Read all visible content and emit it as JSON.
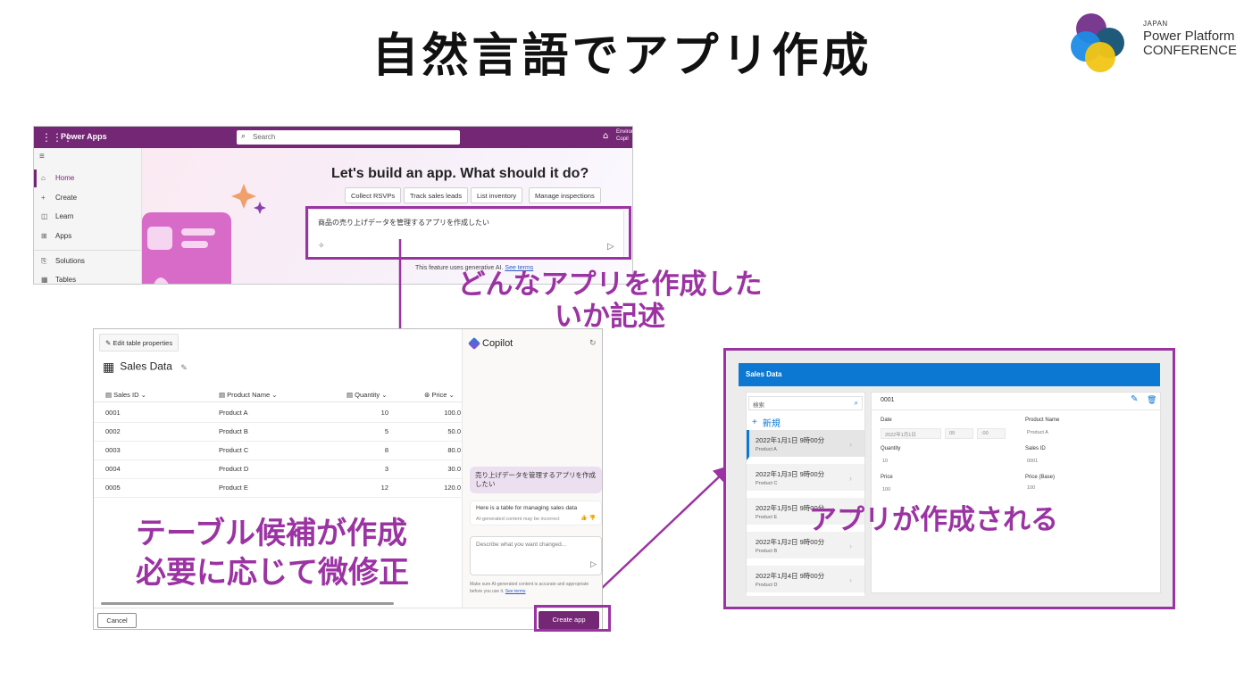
{
  "slide": {
    "title": "自然言語でアプリ作成",
    "logo": {
      "line1": "JAPAN",
      "line2": "Power Platform",
      "line3": "CONFERENCE"
    },
    "captions": {
      "describe": "どんなアプリを作成した\nいか記述",
      "table": "テーブル候補が作成\n必要に応じて微修正",
      "app": "アプリが作成される"
    },
    "accent_color": "#9b33a3"
  },
  "power_apps": {
    "app_name": "Power Apps",
    "search_placeholder": "Search",
    "env_label": "Environ\nCopil",
    "nav": [
      {
        "label": "Home",
        "icon": "home-icon",
        "glyph": "⌂"
      },
      {
        "label": "Create",
        "icon": "plus-icon",
        "glyph": "+"
      },
      {
        "label": "Learn",
        "icon": "book-icon",
        "glyph": "◫"
      },
      {
        "label": "Apps",
        "icon": "apps-icon",
        "glyph": "⊞"
      },
      {
        "label": "Solutions",
        "icon": "solutions-icon",
        "glyph": "⎘"
      },
      {
        "label": "Tables",
        "icon": "tables-icon",
        "glyph": "▦"
      }
    ],
    "heading": "Let's build an app. What should it do?",
    "suggestions": [
      "Collect RSVPs",
      "Track sales leads",
      "List inventory",
      "Manage inspections"
    ],
    "prompt_value": "商品の売り上げデータを管理するアプリを作成したい",
    "disclaimer": "This feature uses generative AI.",
    "disclaimer_link": "See terms",
    "brand_color": "#742774"
  },
  "table_editor": {
    "edit_button": "Edit table properties",
    "table_title": "Sales Data",
    "columns": [
      "Sales ID",
      "Product Name",
      "Quantity",
      "Price"
    ],
    "rows": [
      [
        "0001",
        "Product A",
        "10",
        "100.0"
      ],
      [
        "0002",
        "Product B",
        "5",
        "50.0"
      ],
      [
        "0003",
        "Product C",
        "8",
        "80.0"
      ],
      [
        "0004",
        "Product D",
        "3",
        "30.0"
      ],
      [
        "0005",
        "Product E",
        "12",
        "120.0"
      ]
    ],
    "cancel_label": "Cancel",
    "create_label": "Create app",
    "copilot": {
      "title": "Copilot",
      "user_message": "売り上げデータを管理するアプリを作成したい",
      "bot_message": "Here is a table for managing sales data",
      "bot_sub": "AI-generated content may be incorrect",
      "input_placeholder": "Describe what you want changed...",
      "note": "Make sure AI-generated content is accurate and appropriate before you use it.",
      "note_link": "See terms"
    }
  },
  "generated_app": {
    "header": "Sales Data",
    "search_placeholder": "検索",
    "new_label": "新規",
    "items": [
      {
        "title": "2022年1月1日 9時00分",
        "sub": "Product A"
      },
      {
        "title": "2022年1月3日 9時00分",
        "sub": "Product C"
      },
      {
        "title": "2022年1月5日 9時00分",
        "sub": "Product E"
      },
      {
        "title": "2022年1月2日 9時00分",
        "sub": "Product B"
      },
      {
        "title": "2022年1月4日 9時00分",
        "sub": "Product D"
      }
    ],
    "form_id": "0001",
    "fields": {
      "date_label": "Date",
      "date_value": "2022年1月1日",
      "hour_value": "09",
      "minute_value": ":00",
      "quantity_label": "Quantity",
      "quantity_value": "10",
      "price_label": "Price",
      "price_value": "100",
      "product_label": "Product Name",
      "product_value": "Product A",
      "salesid_label": "Sales ID",
      "salesid_value": "0001",
      "pricebase_label": "Price (Base)",
      "pricebase_value": "100"
    },
    "header_color": "#0d78d1"
  }
}
